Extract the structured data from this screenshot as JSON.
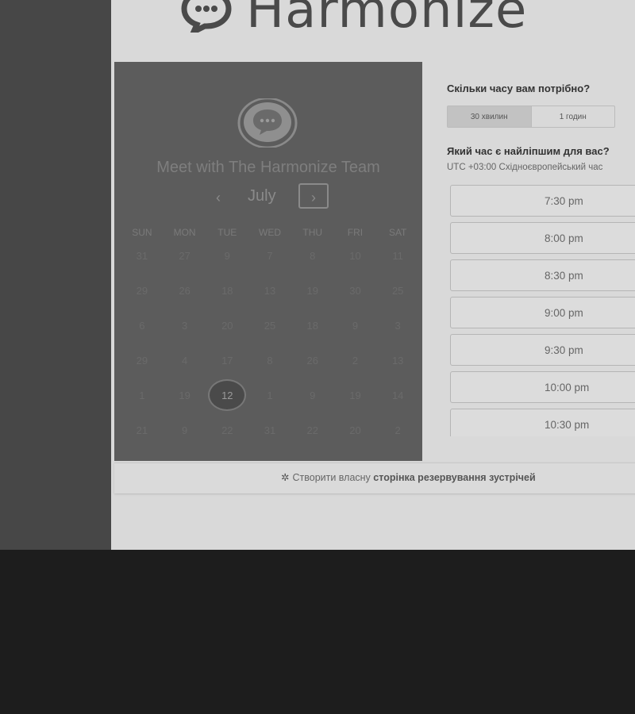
{
  "brand": {
    "name": "Harmonize"
  },
  "calendar": {
    "title": "Meet with The Harmonize Team",
    "month": "July",
    "prev_symbol": "‹",
    "next_symbol": "›",
    "weekdays": [
      "SUN",
      "MON",
      "TUE",
      "WED",
      "THU",
      "FRI",
      "SAT"
    ],
    "weeks": [
      [
        "31",
        "27",
        "9",
        "7",
        "8",
        "10",
        "11"
      ],
      [
        "29",
        "26",
        "18",
        "13",
        "19",
        "30",
        "25"
      ],
      [
        "6",
        "3",
        "20",
        "25",
        "18",
        "9",
        "3"
      ],
      [
        "29",
        "4",
        "17",
        "8",
        "26",
        "2",
        "13"
      ],
      [
        "1",
        "19",
        "12",
        "1",
        "9",
        "19",
        "14"
      ],
      [
        "21",
        "9",
        "22",
        "31",
        "22",
        "20",
        "2"
      ]
    ],
    "selected_day": "12"
  },
  "booking": {
    "duration_question": "Скільки часу вам потрібно?",
    "durations": [
      "30 хвилин",
      "1 годин"
    ],
    "time_question": "Який час є найліпшим для вас?",
    "timezone": "UTC +03:00 Східноєвропейський час",
    "slots": [
      "7:30 pm",
      "8:00 pm",
      "8:30 pm",
      "9:00 pm",
      "9:30 pm",
      "10:00 pm",
      "10:30 pm"
    ]
  },
  "footer": {
    "text": "Створити власну",
    "bold": "сторінка резервування зустрічей"
  }
}
